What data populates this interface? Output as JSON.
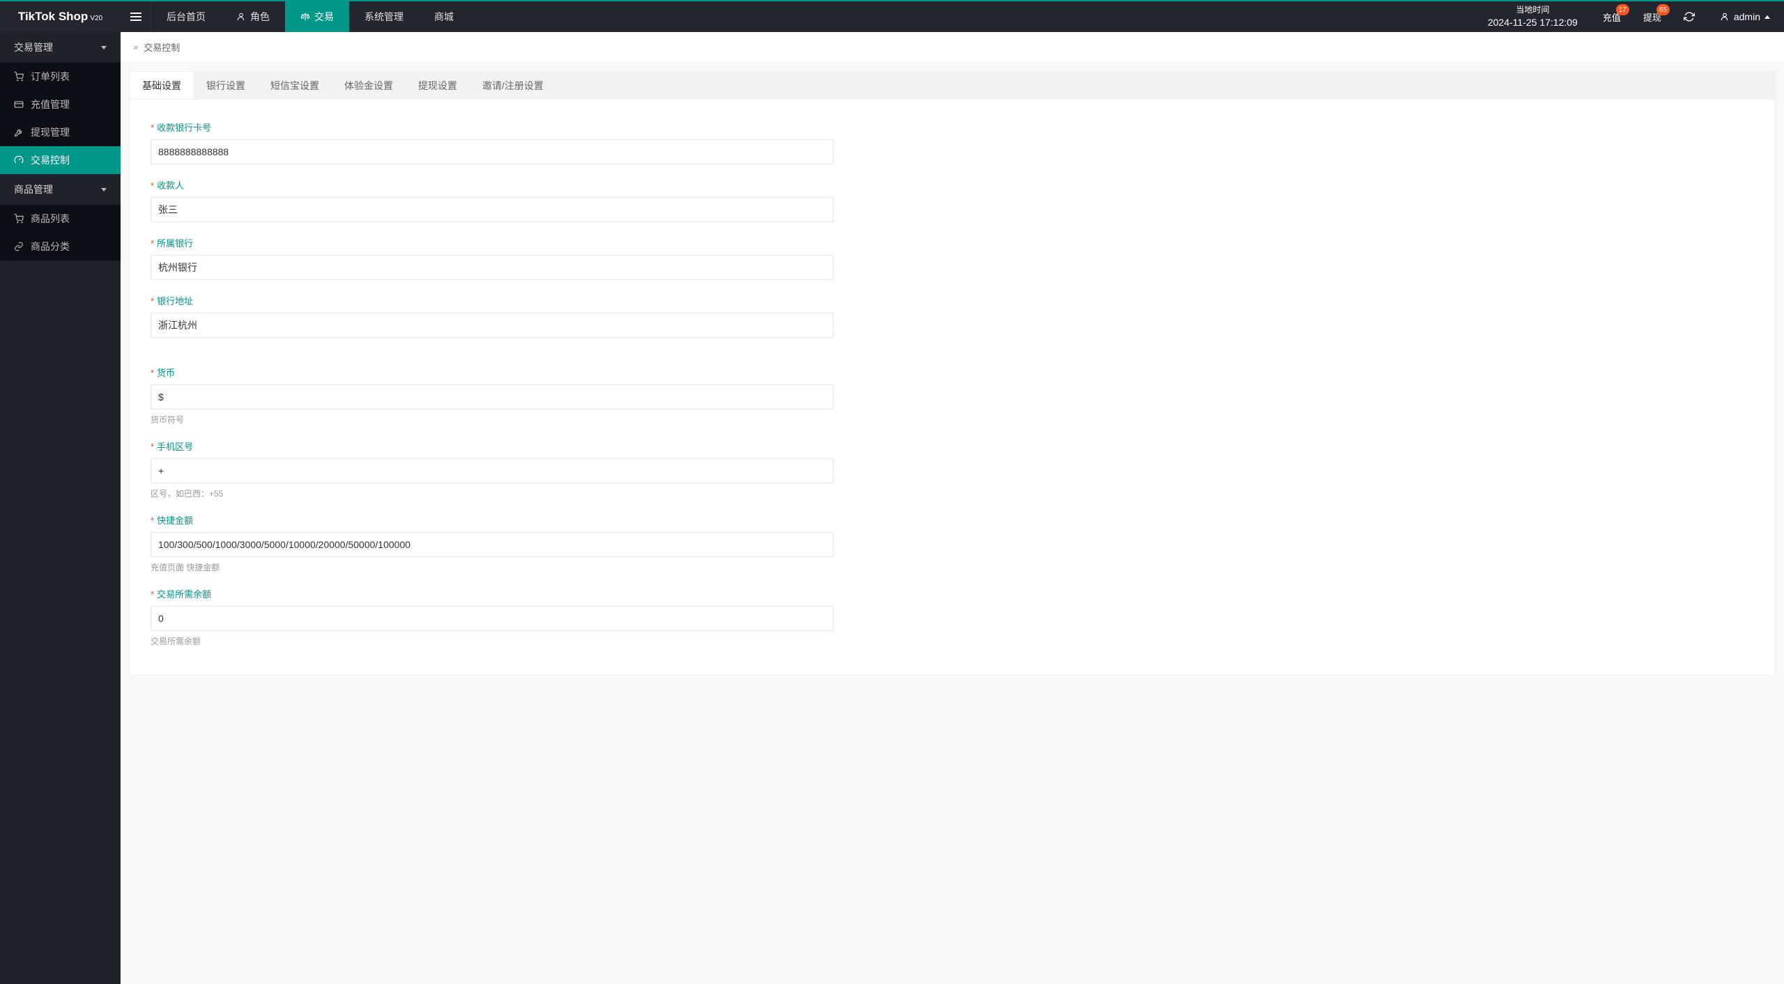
{
  "brand": {
    "name": "TikTok Shop",
    "version": "V20"
  },
  "nav": {
    "home": "后台首页",
    "role": "角色",
    "trade": "交易",
    "system": "系统管理",
    "mall": "商城"
  },
  "header": {
    "time_label": "当地时间",
    "time_value": "2024-11-25 17:12:09",
    "recharge": "充值",
    "withdraw": "提现",
    "recharge_badge": "17",
    "withdraw_badge": "65",
    "admin": "admin"
  },
  "sidebar": {
    "group_trade": "交易管理",
    "items_trade": [
      {
        "label": "订单列表"
      },
      {
        "label": "充值管理"
      },
      {
        "label": "提现管理"
      },
      {
        "label": "交易控制"
      }
    ],
    "group_goods": "商品管理",
    "items_goods": [
      {
        "label": "商品列表"
      },
      {
        "label": "商品分类"
      }
    ]
  },
  "breadcrumb": {
    "current": "交易控制"
  },
  "tabs": {
    "basic": "基础设置",
    "bank": "银行设置",
    "sms": "短信宝设置",
    "trial": "体验金设置",
    "withdraw": "提现设置",
    "invite": "邀请/注册设置"
  },
  "form": {
    "bank_card": {
      "label": "收款银行卡号",
      "value": "8888888888888"
    },
    "payee": {
      "label": "收款人",
      "value": "张三"
    },
    "bank": {
      "label": "所属银行",
      "value": "杭州银行"
    },
    "bank_addr": {
      "label": "银行地址",
      "value": "浙江杭州"
    },
    "currency": {
      "label": "货币",
      "value": "$",
      "help": "货币符号"
    },
    "phone_area": {
      "label": "手机区号",
      "value": "+",
      "help": "区号，如巴西：+55"
    },
    "quick_amount": {
      "label": "快捷金额",
      "value": "100/300/500/1000/3000/5000/10000/20000/50000/100000",
      "help": "充值页面 快捷金额"
    },
    "trade_balance": {
      "label": "交易所需余额",
      "value": "0",
      "help": "交易所需余额"
    }
  }
}
